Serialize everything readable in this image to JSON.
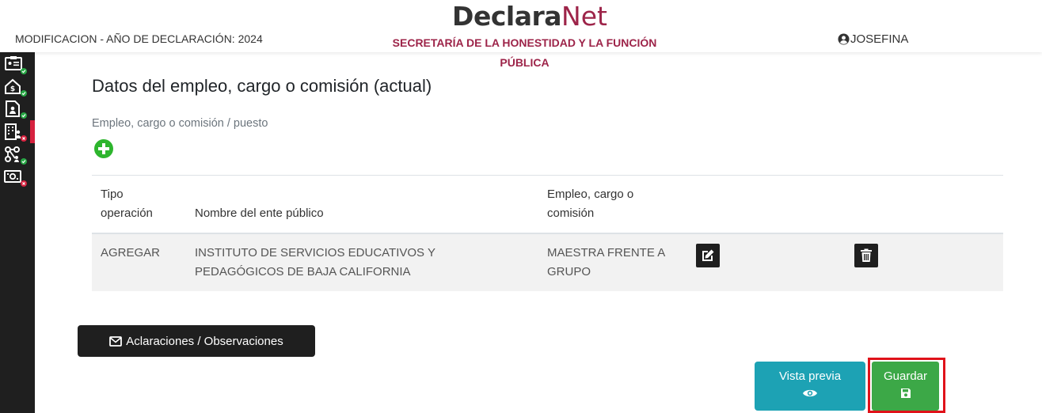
{
  "header": {
    "logo_part1": "Declara",
    "logo_part2": "Net",
    "declaration_info": "MODIFICACION - AÑO DE DECLARACIÓN: 2024",
    "agency_line1": "SECRETARÍA DE LA HONESTIDAD Y LA FUNCIÓN",
    "agency_line2": "PÚBLICA",
    "user_name": "JOSEFINA",
    "user_icon": "user-circle-icon"
  },
  "sidebar": {
    "items": [
      {
        "icon": "id-card-icon",
        "status": "complete",
        "status_color": "#28a745"
      },
      {
        "icon": "house-dollar-icon",
        "status": "complete",
        "status_color": "#28a745"
      },
      {
        "icon": "document-person-icon",
        "status": "complete",
        "status_color": "#28a745"
      },
      {
        "icon": "building-person-icon",
        "status": "incomplete",
        "status_color": "#d6223f"
      },
      {
        "icon": "network-person-icon",
        "status": "complete",
        "status_color": "#28a745"
      },
      {
        "icon": "money-check-icon",
        "status": "incomplete",
        "status_color": "#d6223f"
      }
    ],
    "active_index": 3
  },
  "main": {
    "title": "Datos del empleo, cargo o comisión (actual)",
    "field_label": "Empleo, cargo o comisión / puesto",
    "table": {
      "headers": {
        "tipo_line1": "Tipo",
        "tipo_line2": "operación",
        "nombre": "Nombre del ente público",
        "empleo_line1": "Empleo, cargo o",
        "empleo_line2": "comisión"
      },
      "rows": [
        {
          "tipo": "AGREGAR",
          "nombre_line1": "INSTITUTO DE SERVICIOS EDUCATIVOS Y",
          "nombre_line2": "PEDAGÓGICOS DE BAJA CALIFORNIA",
          "empleo_line1": "MAESTRA FRENTE A",
          "empleo_line2": "GRUPO"
        }
      ]
    }
  },
  "actions": {
    "observaciones_label": "Aclaraciones / Observaciones",
    "vista_previa_label": "Vista previa",
    "guardar_label": "Guardar"
  },
  "colors": {
    "brand": "#9d2449",
    "dark": "#1f1f1f",
    "info": "#1da2b4",
    "success": "#3ca847",
    "highlight": "#e0121a"
  }
}
